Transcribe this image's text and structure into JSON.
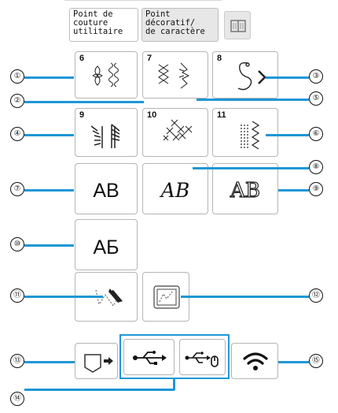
{
  "tabs": [
    {
      "lines": [
        "Point de",
        "couture",
        "utilitaire"
      ]
    },
    {
      "lines": [
        "Point",
        "décoratif/",
        "de caractère"
      ]
    }
  ],
  "keys": [
    {
      "number": "6",
      "id": "decorative-6"
    },
    {
      "number": "7",
      "id": "decorative-7"
    },
    {
      "number": "8",
      "id": "decorative-8"
    },
    {
      "number": "9",
      "id": "decorative-9"
    },
    {
      "number": "10",
      "id": "decorative-10"
    },
    {
      "number": "11",
      "id": "decorative-11"
    }
  ],
  "fonts": [
    {
      "label": "AB",
      "style": "gothic"
    },
    {
      "label": "AB",
      "style": "script"
    },
    {
      "label": "AB",
      "style": "outline"
    },
    {
      "label": "АБ",
      "style": "cyrillic"
    }
  ],
  "icons": {
    "my_custom_stitch": "my-custom-stitch-icon",
    "my_design_center": "my-design-center-icon",
    "memory": "memory-pocket-icon",
    "usb": "usb-icon",
    "usb_mouse": "usb-mouse-icon",
    "wifi": "wifi-icon",
    "tab3": "book-icon"
  },
  "callouts": [
    "①",
    "②",
    "③",
    "④",
    "⑤",
    "⑥",
    "⑦",
    "⑧",
    "⑨",
    "⑩",
    "⑪",
    "⑫",
    "⑬",
    "⑭",
    "⑮"
  ],
  "colors": {
    "leader": "#1f97d6",
    "border": "#b5b5b5",
    "inactive_tab": "#e7e7e7"
  }
}
